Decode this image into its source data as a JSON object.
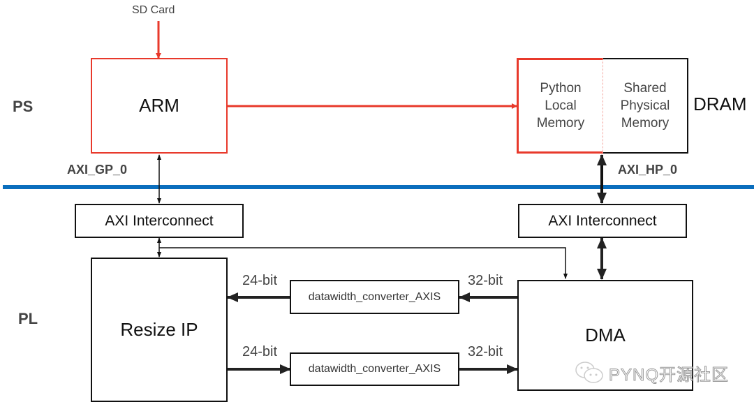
{
  "regions": {
    "ps_label": "PS",
    "pl_label": "PL"
  },
  "sd_card": "SD Card",
  "arm": "ARM",
  "dram": {
    "label": "DRAM",
    "python_local_memory": [
      "Python",
      "Local",
      "Memory"
    ],
    "shared_physical_memory": [
      "Shared",
      "Physical",
      "Memory"
    ]
  },
  "buses": {
    "axi_gp_0": "AXI_GP_0",
    "axi_hp_0": "AXI_HP_0"
  },
  "axi_interconnect_left": "AXI Interconnect",
  "axi_interconnect_right": "AXI Interconnect",
  "resize_ip": "Resize IP",
  "dma": "DMA",
  "converter_top": {
    "label": "datawidth_converter_AXIS",
    "in_width": "32-bit",
    "out_width": "24-bit"
  },
  "converter_bottom": {
    "label": "datawidth_converter_AXIS",
    "in_width": "24-bit",
    "out_width": "32-bit"
  },
  "watermark": "PYNQ开源社区",
  "colors": {
    "ps_accent": "#e8392b",
    "divider": "#0a6ebd",
    "line": "#111111"
  }
}
